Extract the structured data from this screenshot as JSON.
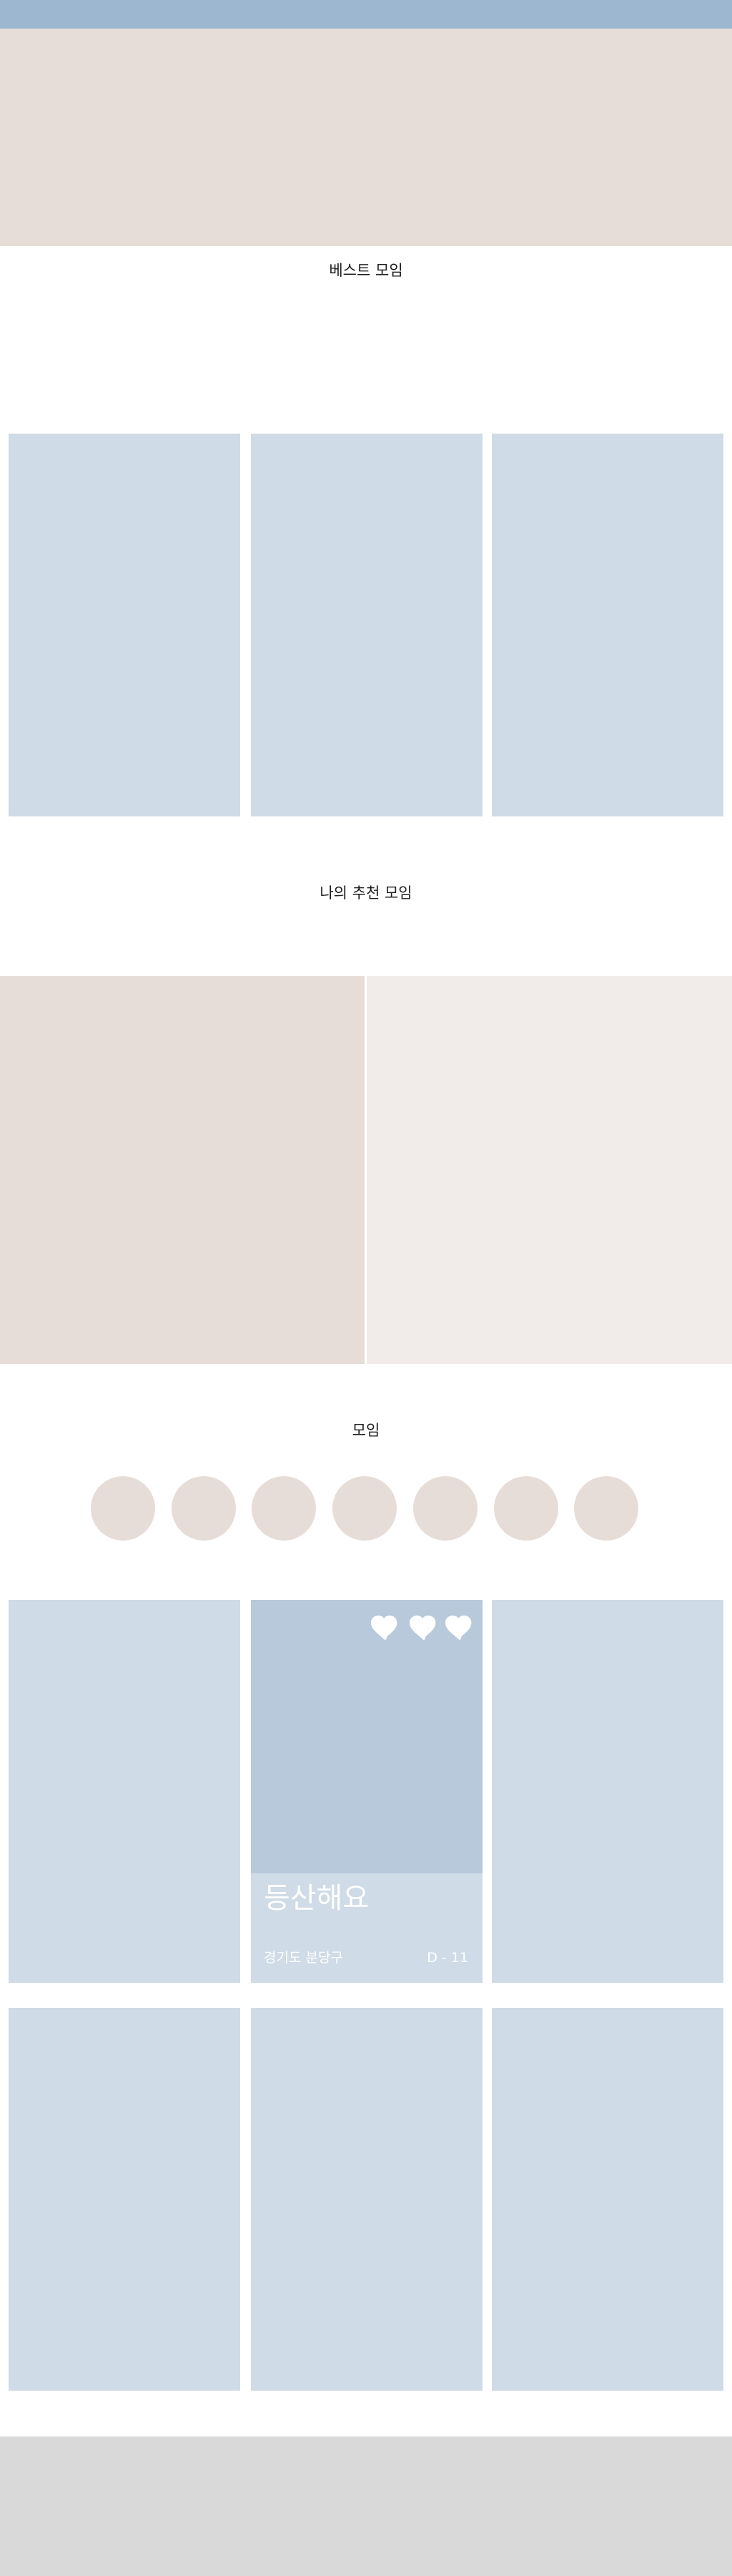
{
  "sections": {
    "best_title": "베스트 모임",
    "recommended_title": "나의 추천 모임",
    "meetings_title": "모임"
  },
  "feature_card": {
    "title": "등산해요",
    "location": "경기도 분당구",
    "dday": "D - 11",
    "icons": [
      "heart-icon",
      "heart-icon",
      "heart-icon"
    ]
  },
  "colors": {
    "topbar": "#9db7d1",
    "hero": "#e7ddd8",
    "card": "#cfdbe6",
    "card_image": "#b7c9da",
    "rec_left": "#e7ddd8",
    "rec_right": "#f1ece9",
    "circle": "#e7ddd8",
    "footer": "#d9d9d9"
  }
}
